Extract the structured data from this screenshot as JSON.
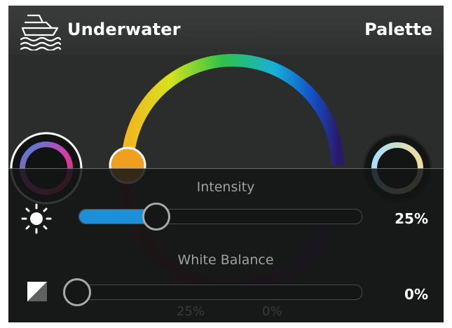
{
  "header": {
    "title": "Underwater",
    "palette_label": "Palette",
    "icon": "boat-icon"
  },
  "intensity": {
    "label": "Intensity",
    "value_text": "25%",
    "level": 0.25,
    "icon": "sun-icon",
    "fill_color": "#1d8fd6"
  },
  "white_balance": {
    "label": "White Balance",
    "value_text": "0%",
    "level": 0.0,
    "icon": "white-balance-icon"
  },
  "background_faint": {
    "left": "25%",
    "right": "0%"
  },
  "colors": {
    "panel": "#2b2d2d",
    "accent_orange": "#f0a020"
  }
}
